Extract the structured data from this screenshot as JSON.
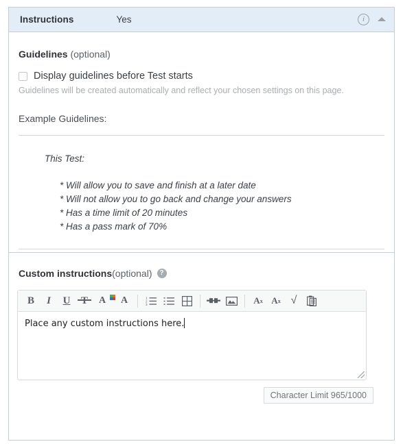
{
  "header": {
    "title": "Instructions",
    "value": "Yes",
    "info_icon": "info-circle-icon",
    "collapse_icon": "caret-up-icon"
  },
  "guidelines": {
    "label_strong": "Guidelines",
    "label_optional": "(optional)",
    "checkbox_label": "Display guidelines before Test starts",
    "checkbox_checked": false,
    "hint": "Guidelines will be created automatically and reflect your chosen settings on this page.",
    "example_label": "Example Guidelines:",
    "example_title": "This Test:",
    "example_items": [
      "* Will allow you to save and finish at a later date",
      "* Will not allow you to go back and change your answers",
      "* Has a time limit of 20 minutes",
      "* Has a pass mark of 70%"
    ]
  },
  "custom": {
    "label_strong": "Custom instructions",
    "label_optional": "(optional)",
    "help_icon": "question-mark-icon",
    "help_glyph": "?",
    "toolbar": [
      {
        "name": "bold-button",
        "glyph": "B"
      },
      {
        "name": "italic-button",
        "glyph": "I"
      },
      {
        "name": "underline-button",
        "glyph": "U"
      },
      {
        "name": "strikethrough-button",
        "glyph": "T"
      },
      {
        "name": "text-color-button",
        "glyph": "A"
      },
      {
        "name": "background-color-button",
        "glyph": "A"
      },
      {
        "name": "numbered-list-button",
        "glyph": ""
      },
      {
        "name": "bullet-list-button",
        "glyph": ""
      },
      {
        "name": "table-button",
        "glyph": ""
      },
      {
        "name": "link-button",
        "glyph": ""
      },
      {
        "name": "image-button",
        "glyph": ""
      },
      {
        "name": "superscript-button",
        "glyph": "A"
      },
      {
        "name": "subscript-button",
        "glyph": "A"
      },
      {
        "name": "math-button",
        "glyph": "√"
      },
      {
        "name": "paste-button",
        "glyph": ""
      }
    ],
    "superscript_mark": "x",
    "subscript_mark": "x",
    "editor_text": "Place any custom instructions here.",
    "character_limit": "Character Limit 965/1000"
  },
  "colors": {
    "header_background": "#e3edf7",
    "panel_border": "#c8cdd2",
    "toolbar_background": "#f7f8f8",
    "swatch_top_left": "#3cb44b",
    "swatch_top_right": "#e8711a",
    "swatch_bottom_left": "#2a6fd6",
    "swatch_bottom_right": "#d63b2f"
  }
}
